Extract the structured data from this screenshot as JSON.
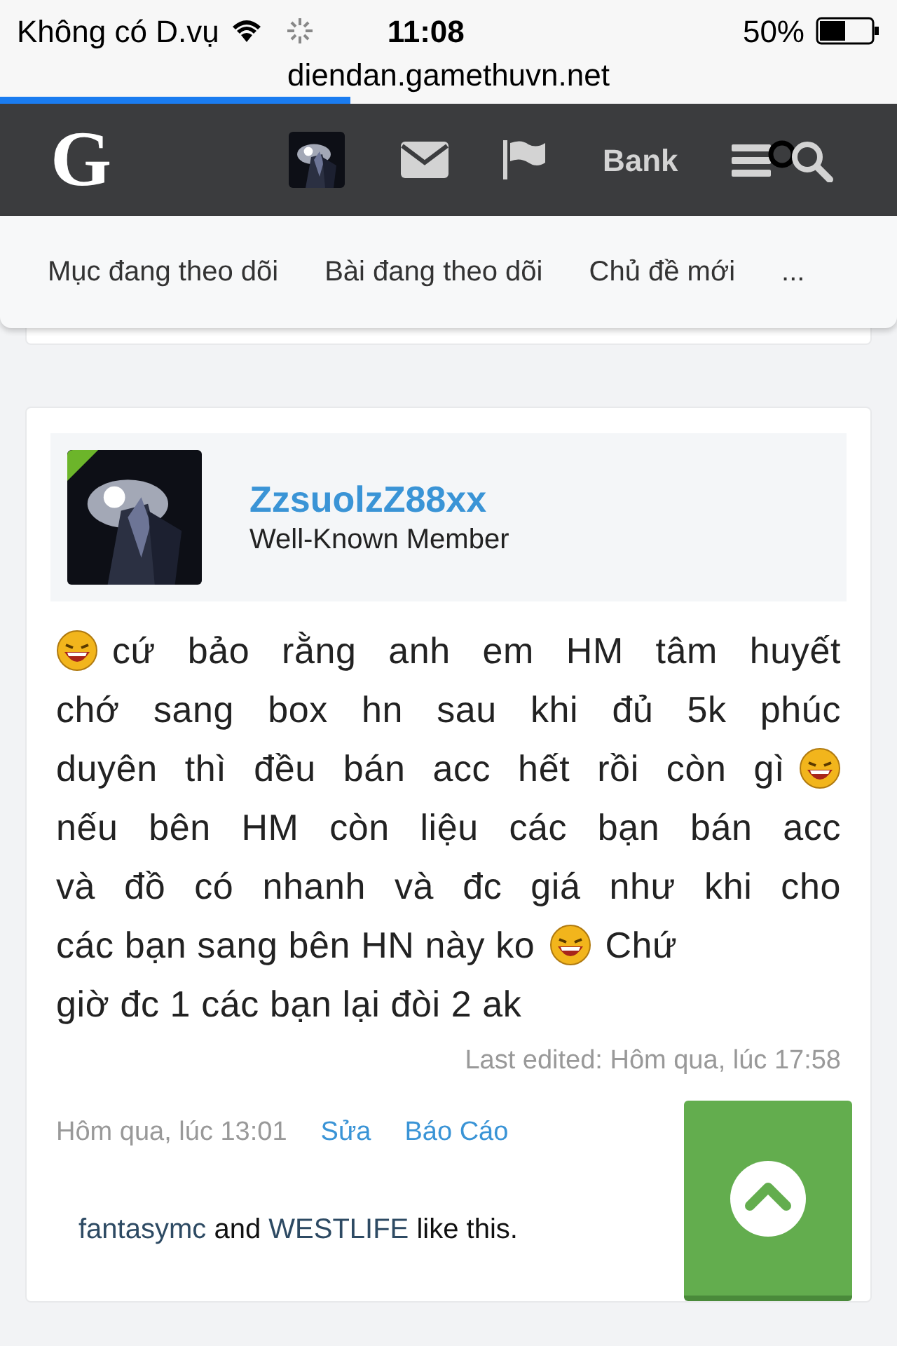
{
  "status_bar": {
    "carrier": "Không có D.vụ",
    "time": "11:08",
    "battery_text": "50%"
  },
  "browser": {
    "url": "diendan.gamethuvn.net",
    "progress": {
      "level": 0.39
    }
  },
  "nav": {
    "logo": "G",
    "bank": "Bank"
  },
  "subnav": {
    "items": [
      "Mục đang theo dõi",
      "Bài đang theo dõi",
      "Chủ đề mới",
      "..."
    ]
  },
  "post": {
    "user": {
      "name": "ZzsuolzZ88xx",
      "title": "Well-Known Member",
      "online": true
    },
    "body": [
      [
        {
          "kind": "emoji"
        },
        {
          "kind": "text",
          "text": "cứ bảo rằng anh em HM tâm huyết"
        }
      ],
      [
        {
          "kind": "text",
          "text": "chớ sang box hn sau khi đủ 5k phúc"
        }
      ],
      [
        {
          "kind": "text",
          "text": "duyên thì đều bán acc hết rồi còn gì"
        },
        {
          "kind": "emoji"
        }
      ],
      [
        {
          "kind": "text",
          "text": "nếu bên HM còn liệu các bạn bán acc"
        }
      ],
      [
        {
          "kind": "text",
          "text": "và đồ có nhanh và đc giá như khi cho"
        }
      ],
      [
        {
          "kind": "text",
          "text": "các bạn sang bên HN này ko"
        },
        {
          "kind": "emoji"
        },
        {
          "kind": "text",
          "text": "Chứ"
        }
      ],
      [
        {
          "kind": "text",
          "text": "giờ đc 1 các bạn lại đòi 2 ak"
        }
      ]
    ],
    "last_edited": "Last edited: Hôm qua, lúc 17:58",
    "date": "Hôm qua, lúc 13:01",
    "actions": [
      "Sửa",
      "Báo Cáo"
    ],
    "likes": [
      {
        "kind": "user",
        "text": "fantasymc"
      },
      {
        "kind": "text",
        "text": " and "
      },
      {
        "kind": "user",
        "text": "WESTLIFE"
      },
      {
        "kind": "text",
        "text": " like this."
      }
    ]
  }
}
